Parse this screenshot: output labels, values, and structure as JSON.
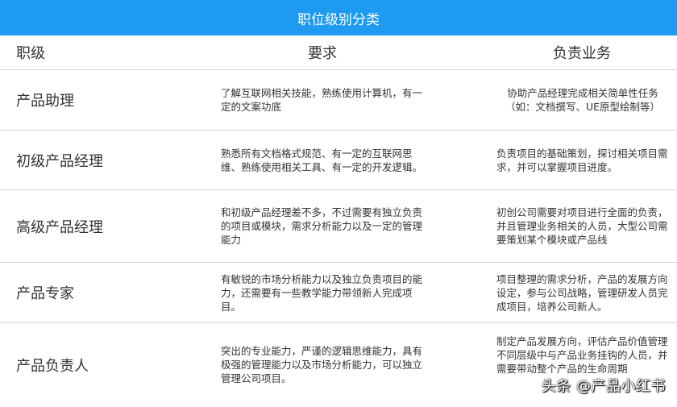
{
  "title": "职位级别分类",
  "headers": {
    "level": "职级",
    "requirement": "要求",
    "duty": "负责业务"
  },
  "rows": [
    {
      "level": "产品助理",
      "requirement": "了解互联网相关技能，熟练使用计算机，有一定的文案功底",
      "duty": "协助产品经理完成相关简单性任务（如：文档撰写、UE原型绘制等）"
    },
    {
      "level": "初级产品经理",
      "requirement": "熟悉所有文档格式规范、有一定的互联网思维、熟练使用相关工具、有一定的开发逻辑。",
      "duty": "负责项目的基础策划，探讨相关项目需求，并可以掌握项目进度。"
    },
    {
      "level": "高级产品经理",
      "requirement": "和初级产品经理差不多，不过需要有独立负责的项目或模块，需求分析能力以及一定的管理能力",
      "duty": "初创公司需要对项目进行全面的负责，并且管理业务相关的人员，大型公司需要策划某个模块或产品线"
    },
    {
      "level": "产品专家",
      "requirement": "有敏锐的市场分析能力以及独立负责项目的能力，还需要有一些教学能力带领新人完成项目。",
      "duty": "项目整理的需求分析，产品的发展方向设定，参与公司战略，管理研发人员完成项目，培养公司新人。"
    },
    {
      "level": "产品负责人",
      "requirement": "突出的专业能力，严谨的逻辑思维能力，具有极强的管理能力以及市场分析能力，可以独立管理公司项目。",
      "duty": "制定产品发展方向，评估产品价值管理不同层级中与产品业务挂钩的人员，并需要带动整个产品的生命周期"
    }
  ],
  "watermark": "头条 @产品小红书",
  "colors": {
    "title_bar": "#1e9bf0",
    "divider": "#d4d4d4",
    "text": "#333333"
  }
}
